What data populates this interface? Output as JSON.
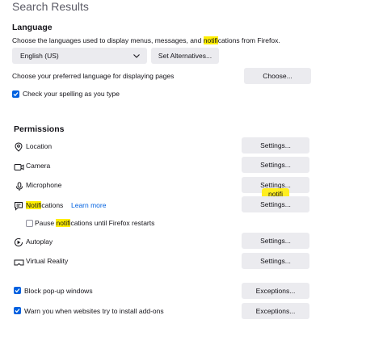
{
  "header": {
    "title": "Search Results"
  },
  "language": {
    "heading": "Language",
    "description_before": "Choose the languages used to display menus, messages, and ",
    "description_highlight": "notifi",
    "description_after": "cations from Firefox.",
    "select_value": "English (US)",
    "set_alternatives_label": "Set Alternatives...",
    "page_language_text": "Choose your preferred language for displaying pages",
    "choose_label": "Choose...",
    "spelling_label": "Check your spelling as you type",
    "spelling_checked": true
  },
  "permissions": {
    "heading": "Permissions",
    "items": [
      {
        "label": "Location",
        "button": "Settings..."
      },
      {
        "label": "Camera",
        "button": "Settings..."
      },
      {
        "label": "Microphone",
        "button": "Settings..."
      },
      {
        "label_highlight": "Notifi",
        "label_rest": "cations",
        "learn_more": "Learn more",
        "button": "Settings..."
      },
      {
        "label": "Autoplay",
        "button": "Settings..."
      },
      {
        "label": "Virtual Reality",
        "button": "Settings..."
      }
    ],
    "pause": {
      "before": "Pause ",
      "highlight": "notifi",
      "after": "cations until Firefox restarts",
      "checked": false
    },
    "tooltip": "notifi",
    "block_popups": {
      "label": "Block pop-up windows",
      "button": "Exceptions...",
      "checked": true
    },
    "warn_addons": {
      "label": "Warn you when websites try to install add-ons",
      "button": "Exceptions...",
      "checked": true
    }
  },
  "colors": {
    "accent": "#0061e0",
    "highlight": "#ffee00",
    "button_bg": "#ebebef"
  }
}
